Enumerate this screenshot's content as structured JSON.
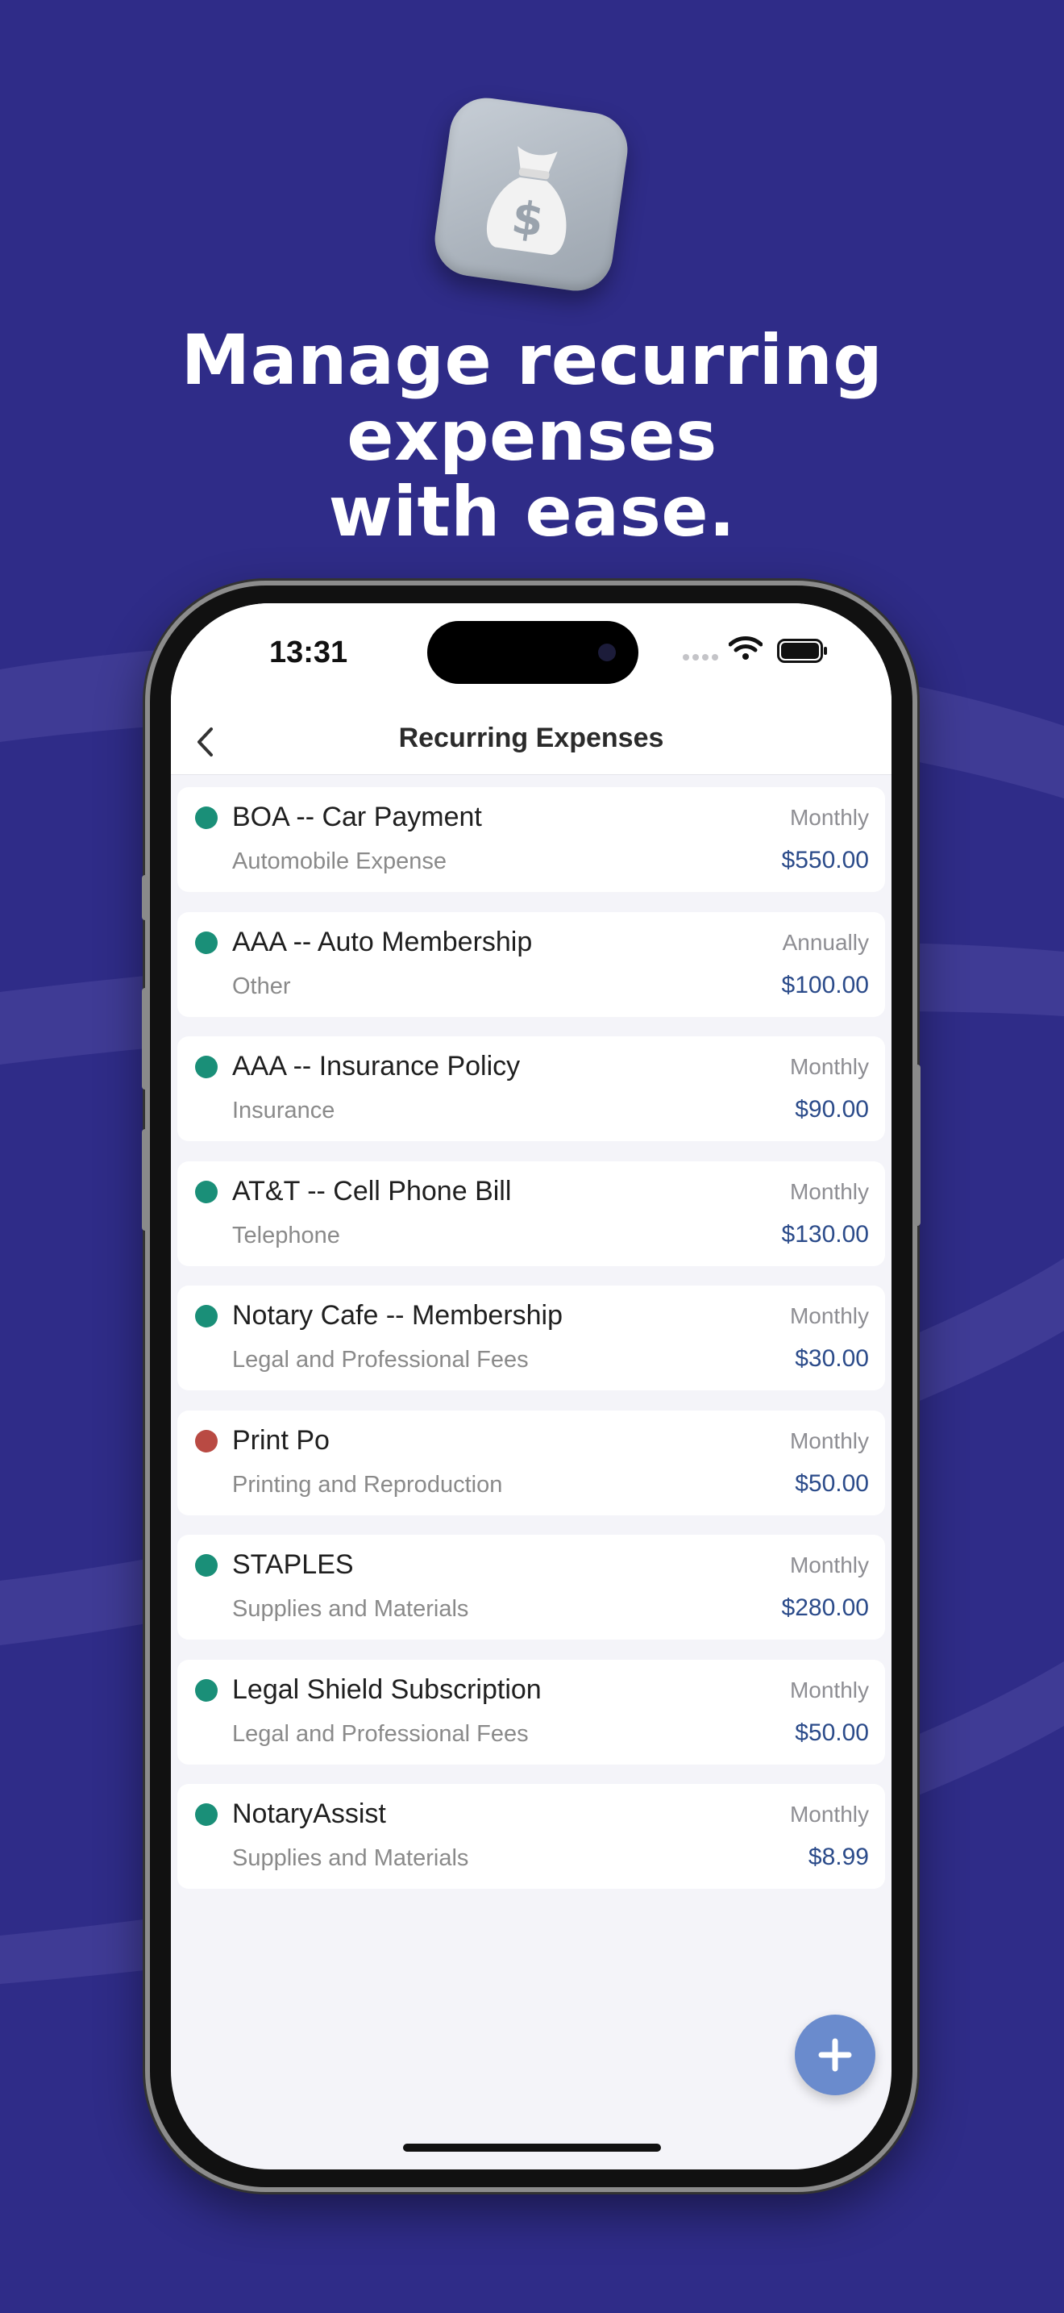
{
  "page": {
    "headline_line1": "Manage recurring expenses",
    "headline_line2": "with ease.",
    "app_icon": "money-bag-icon",
    "background_color": "#2f2c88"
  },
  "status_bar": {
    "time": "13:31",
    "icons": [
      "signal-icon",
      "wifi-icon",
      "battery-icon"
    ]
  },
  "nav": {
    "title": "Recurring Expenses",
    "back_icon": "chevron-left-icon"
  },
  "colors": {
    "active": "#1a8f78",
    "inactive": "#b94a43",
    "amount": "#2b4b8a",
    "fab": "#6a8bcd"
  },
  "expenses": [
    {
      "name": "BOA -- Car Payment",
      "category": "Automobile Expense",
      "frequency": "Monthly",
      "amount": "$550.00",
      "status": "active"
    },
    {
      "name": "AAA -- Auto Membership",
      "category": "Other",
      "frequency": "Annually",
      "amount": "$100.00",
      "status": "active"
    },
    {
      "name": "AAA -- Insurance Policy",
      "category": "Insurance",
      "frequency": "Monthly",
      "amount": "$90.00",
      "status": "active"
    },
    {
      "name": "AT&T -- Cell Phone Bill",
      "category": "Telephone",
      "frequency": "Monthly",
      "amount": "$130.00",
      "status": "active"
    },
    {
      "name": "Notary Cafe -- Membership",
      "category": "Legal and Professional Fees",
      "frequency": "Monthly",
      "amount": "$30.00",
      "status": "active"
    },
    {
      "name": "Print Po",
      "category": "Printing and Reproduction",
      "frequency": "Monthly",
      "amount": "$50.00",
      "status": "inactive"
    },
    {
      "name": "STAPLES",
      "category": "Supplies and Materials",
      "frequency": "Monthly",
      "amount": "$280.00",
      "status": "active"
    },
    {
      "name": "Legal Shield Subscription",
      "category": "Legal and Professional Fees",
      "frequency": "Monthly",
      "amount": "$50.00",
      "status": "active"
    },
    {
      "name": "NotaryAssist",
      "category": "Supplies and Materials",
      "frequency": "Monthly",
      "amount": "$8.99",
      "status": "active"
    }
  ],
  "fab_icon": "plus-icon"
}
